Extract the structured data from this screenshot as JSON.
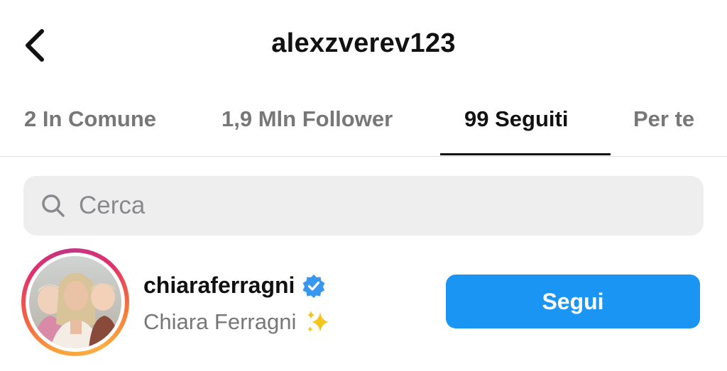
{
  "header": {
    "title": "alexzverev123",
    "back_icon": "chevron-left-icon"
  },
  "tabs": [
    {
      "label": "2 In Comune",
      "active": false
    },
    {
      "label": "1,9 Mln Follower",
      "active": false
    },
    {
      "label": "99 Seguiti",
      "active": true
    },
    {
      "label": "Per te",
      "active": false
    }
  ],
  "search": {
    "placeholder": "Cerca",
    "value": "",
    "icon": "search-icon"
  },
  "list": [
    {
      "username": "chiaraferragni",
      "verified": true,
      "full_name": "Chiara Ferragni",
      "name_emoji": "sparkles-icon",
      "button_label": "Segui",
      "has_story_ring": true
    }
  ],
  "colors": {
    "accent": "#1a95f4",
    "verified": "#3897f0",
    "tab_inactive": "#777777",
    "search_bg": "#eeeeef"
  }
}
